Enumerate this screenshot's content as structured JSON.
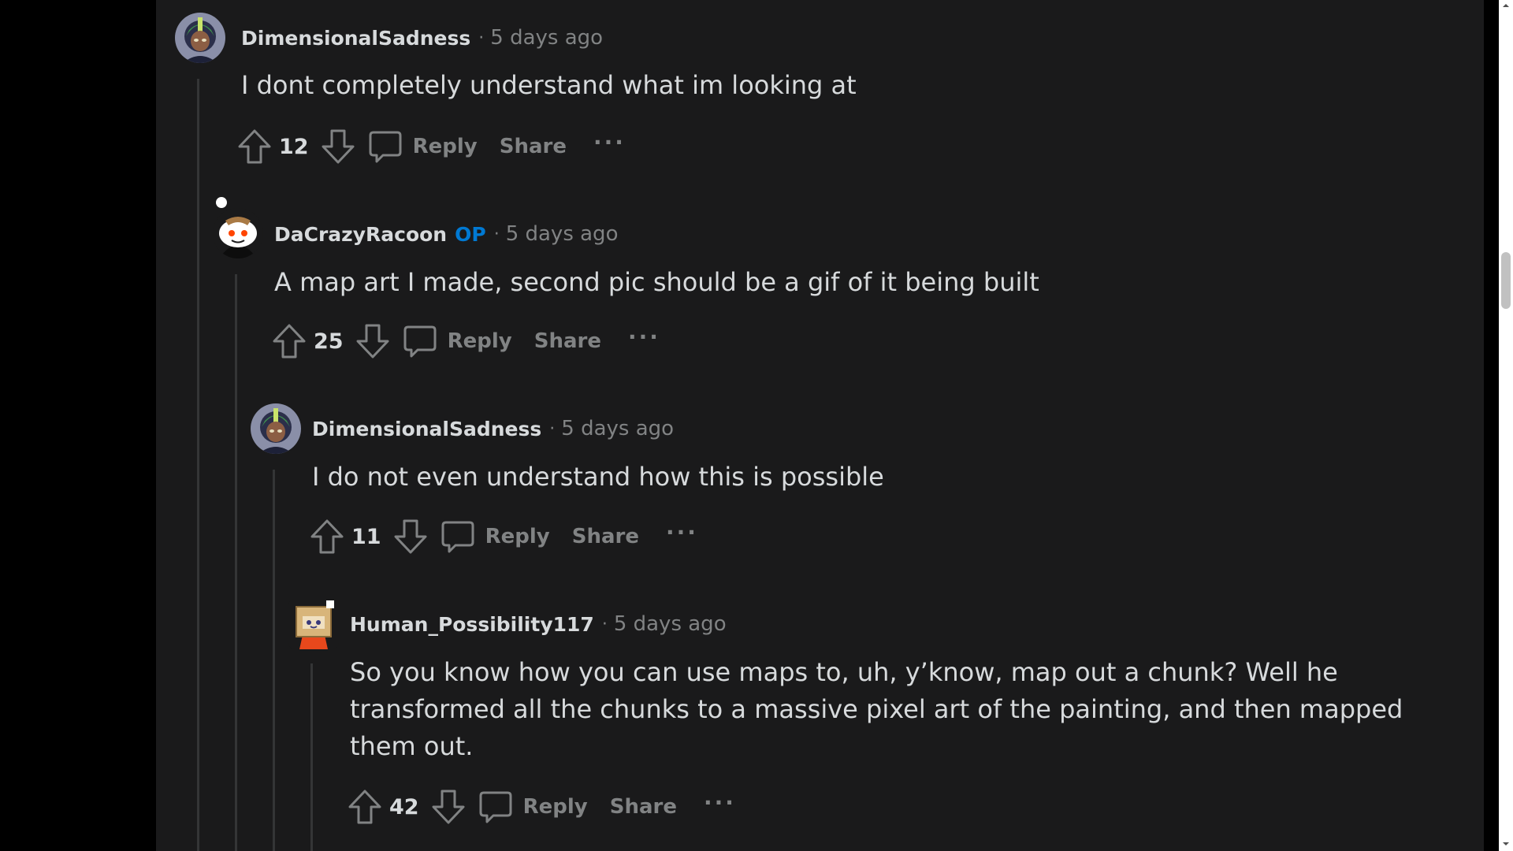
{
  "comments": [
    {
      "username": "DimensionalSadness",
      "op_badge": "",
      "time": "5 days ago",
      "avatar": "anime-character-avatar-icon",
      "text_lines": [
        "I dont completely understand what im looking at"
      ],
      "score": "12"
    },
    {
      "username": "DaCrazyRacoon",
      "op_badge": "OP",
      "time": "5 days ago",
      "avatar": "snoo-avatar-icon",
      "text_lines": [
        "A map art I made, second pic should be a gif of it being built"
      ],
      "score": "25"
    },
    {
      "username": "DimensionalSadness",
      "op_badge": "",
      "time": "5 days ago",
      "avatar": "anime-character-avatar-icon",
      "text_lines": [
        "I do not even understand how this is possible"
      ],
      "score": "11"
    },
    {
      "username": "Human_Possibility117",
      "op_badge": "",
      "time": "5 days ago",
      "avatar": "box-head-snoo-avatar-icon",
      "text_lines": [
        "So you know how you can use maps to, uh, y’know, map out a chunk? Well he",
        "transformed all the chunks to a massive pixel art of the painting, and then mapped",
        "them out."
      ],
      "score": "42"
    }
  ],
  "labels": {
    "separator": "·",
    "reply": "Reply",
    "share": "Share",
    "more": "···"
  },
  "colors": {
    "background": "#1A1A1B",
    "text": "#D7DADC",
    "muted": "#818384",
    "op": "#0079D3",
    "thread_line": "#343536"
  }
}
